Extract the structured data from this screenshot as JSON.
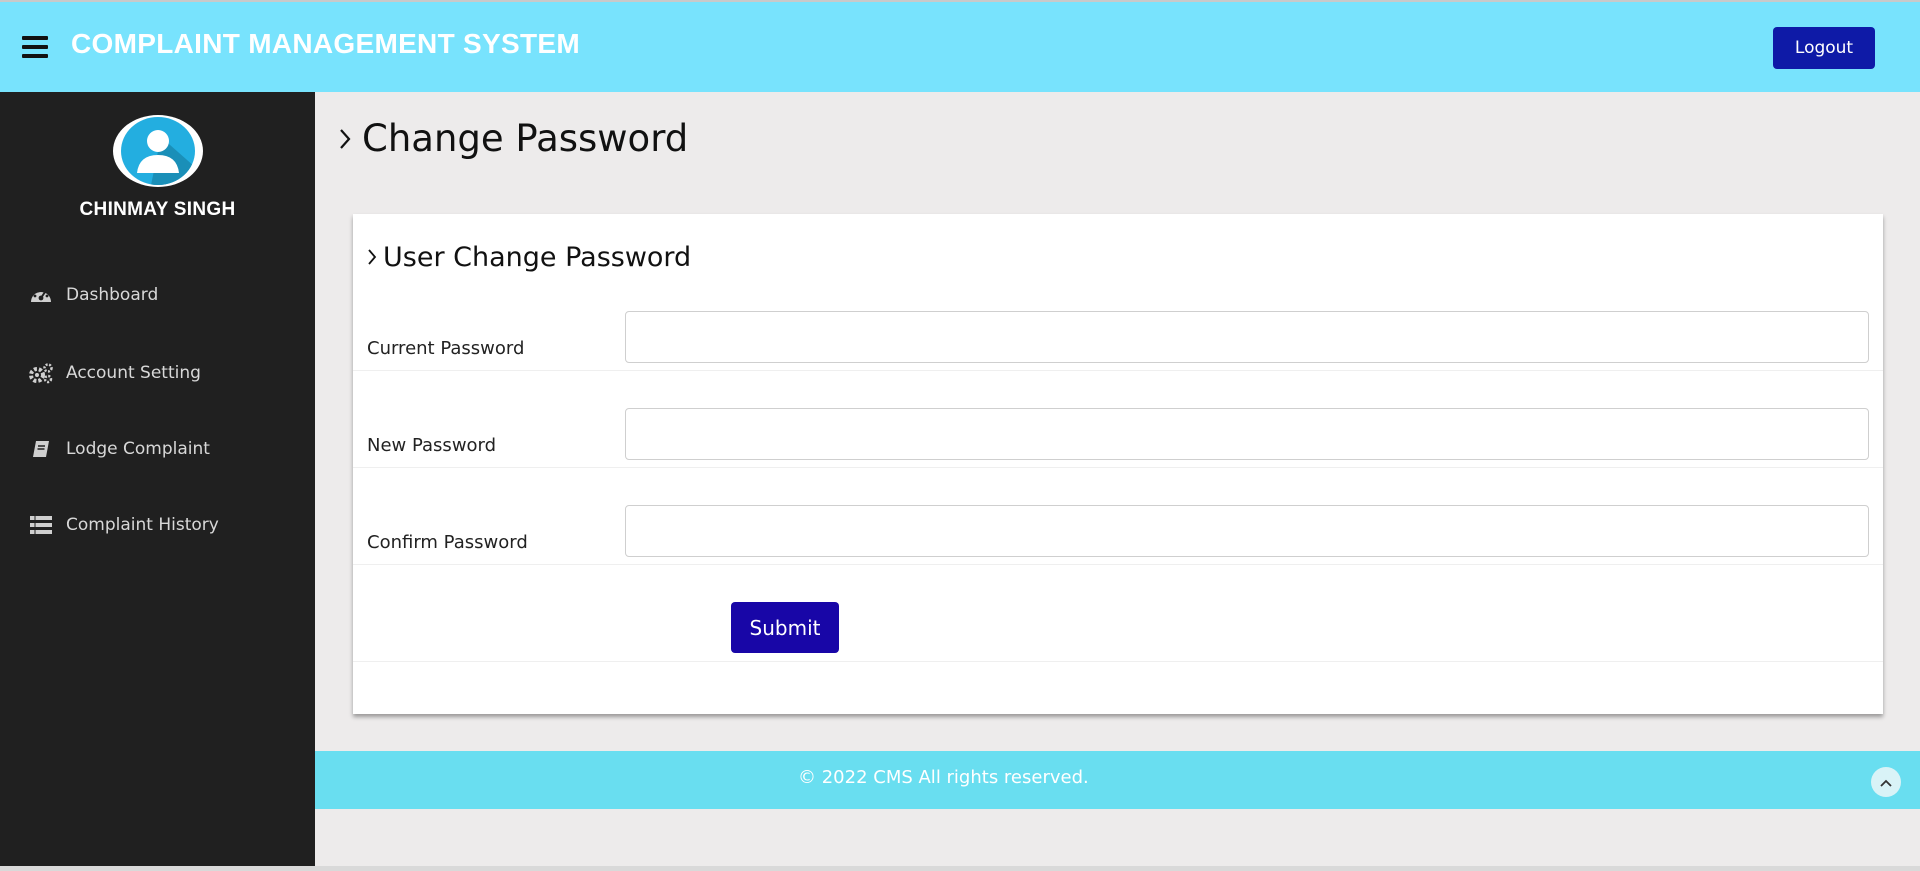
{
  "header": {
    "app_title": "COMPLAINT MANAGEMENT SYSTEM",
    "logout_label": "Logout",
    "menu_icon": "hamburger-icon"
  },
  "sidebar": {
    "user_name": "CHINMAY SINGH",
    "avatar_icon": "user-avatar-icon",
    "items": [
      {
        "label": "Dashboard",
        "icon": "dashboard-icon"
      },
      {
        "label": "Account Setting",
        "icon": "gears-icon"
      },
      {
        "label": "Lodge Complaint",
        "icon": "book-icon"
      },
      {
        "label": "Complaint History",
        "icon": "list-icon"
      }
    ]
  },
  "main": {
    "page_title": "Change Password",
    "card_title": "User Change Password",
    "fields": [
      {
        "label": "Current Password",
        "value": ""
      },
      {
        "label": "New Password",
        "value": ""
      },
      {
        "label": "Confirm Password",
        "value": ""
      }
    ],
    "submit_label": "Submit"
  },
  "footer": {
    "text": "© 2022 CMS All rights reserved.",
    "scroll_icon": "chevron-up-icon"
  },
  "colors": {
    "header_bg": "#78e3fd",
    "sidebar_bg": "#202020",
    "button_primary": "#0e1aa7",
    "submit_bg": "#1806a7",
    "footer_bg": "#69def0",
    "page_bg": "#edebeb"
  }
}
